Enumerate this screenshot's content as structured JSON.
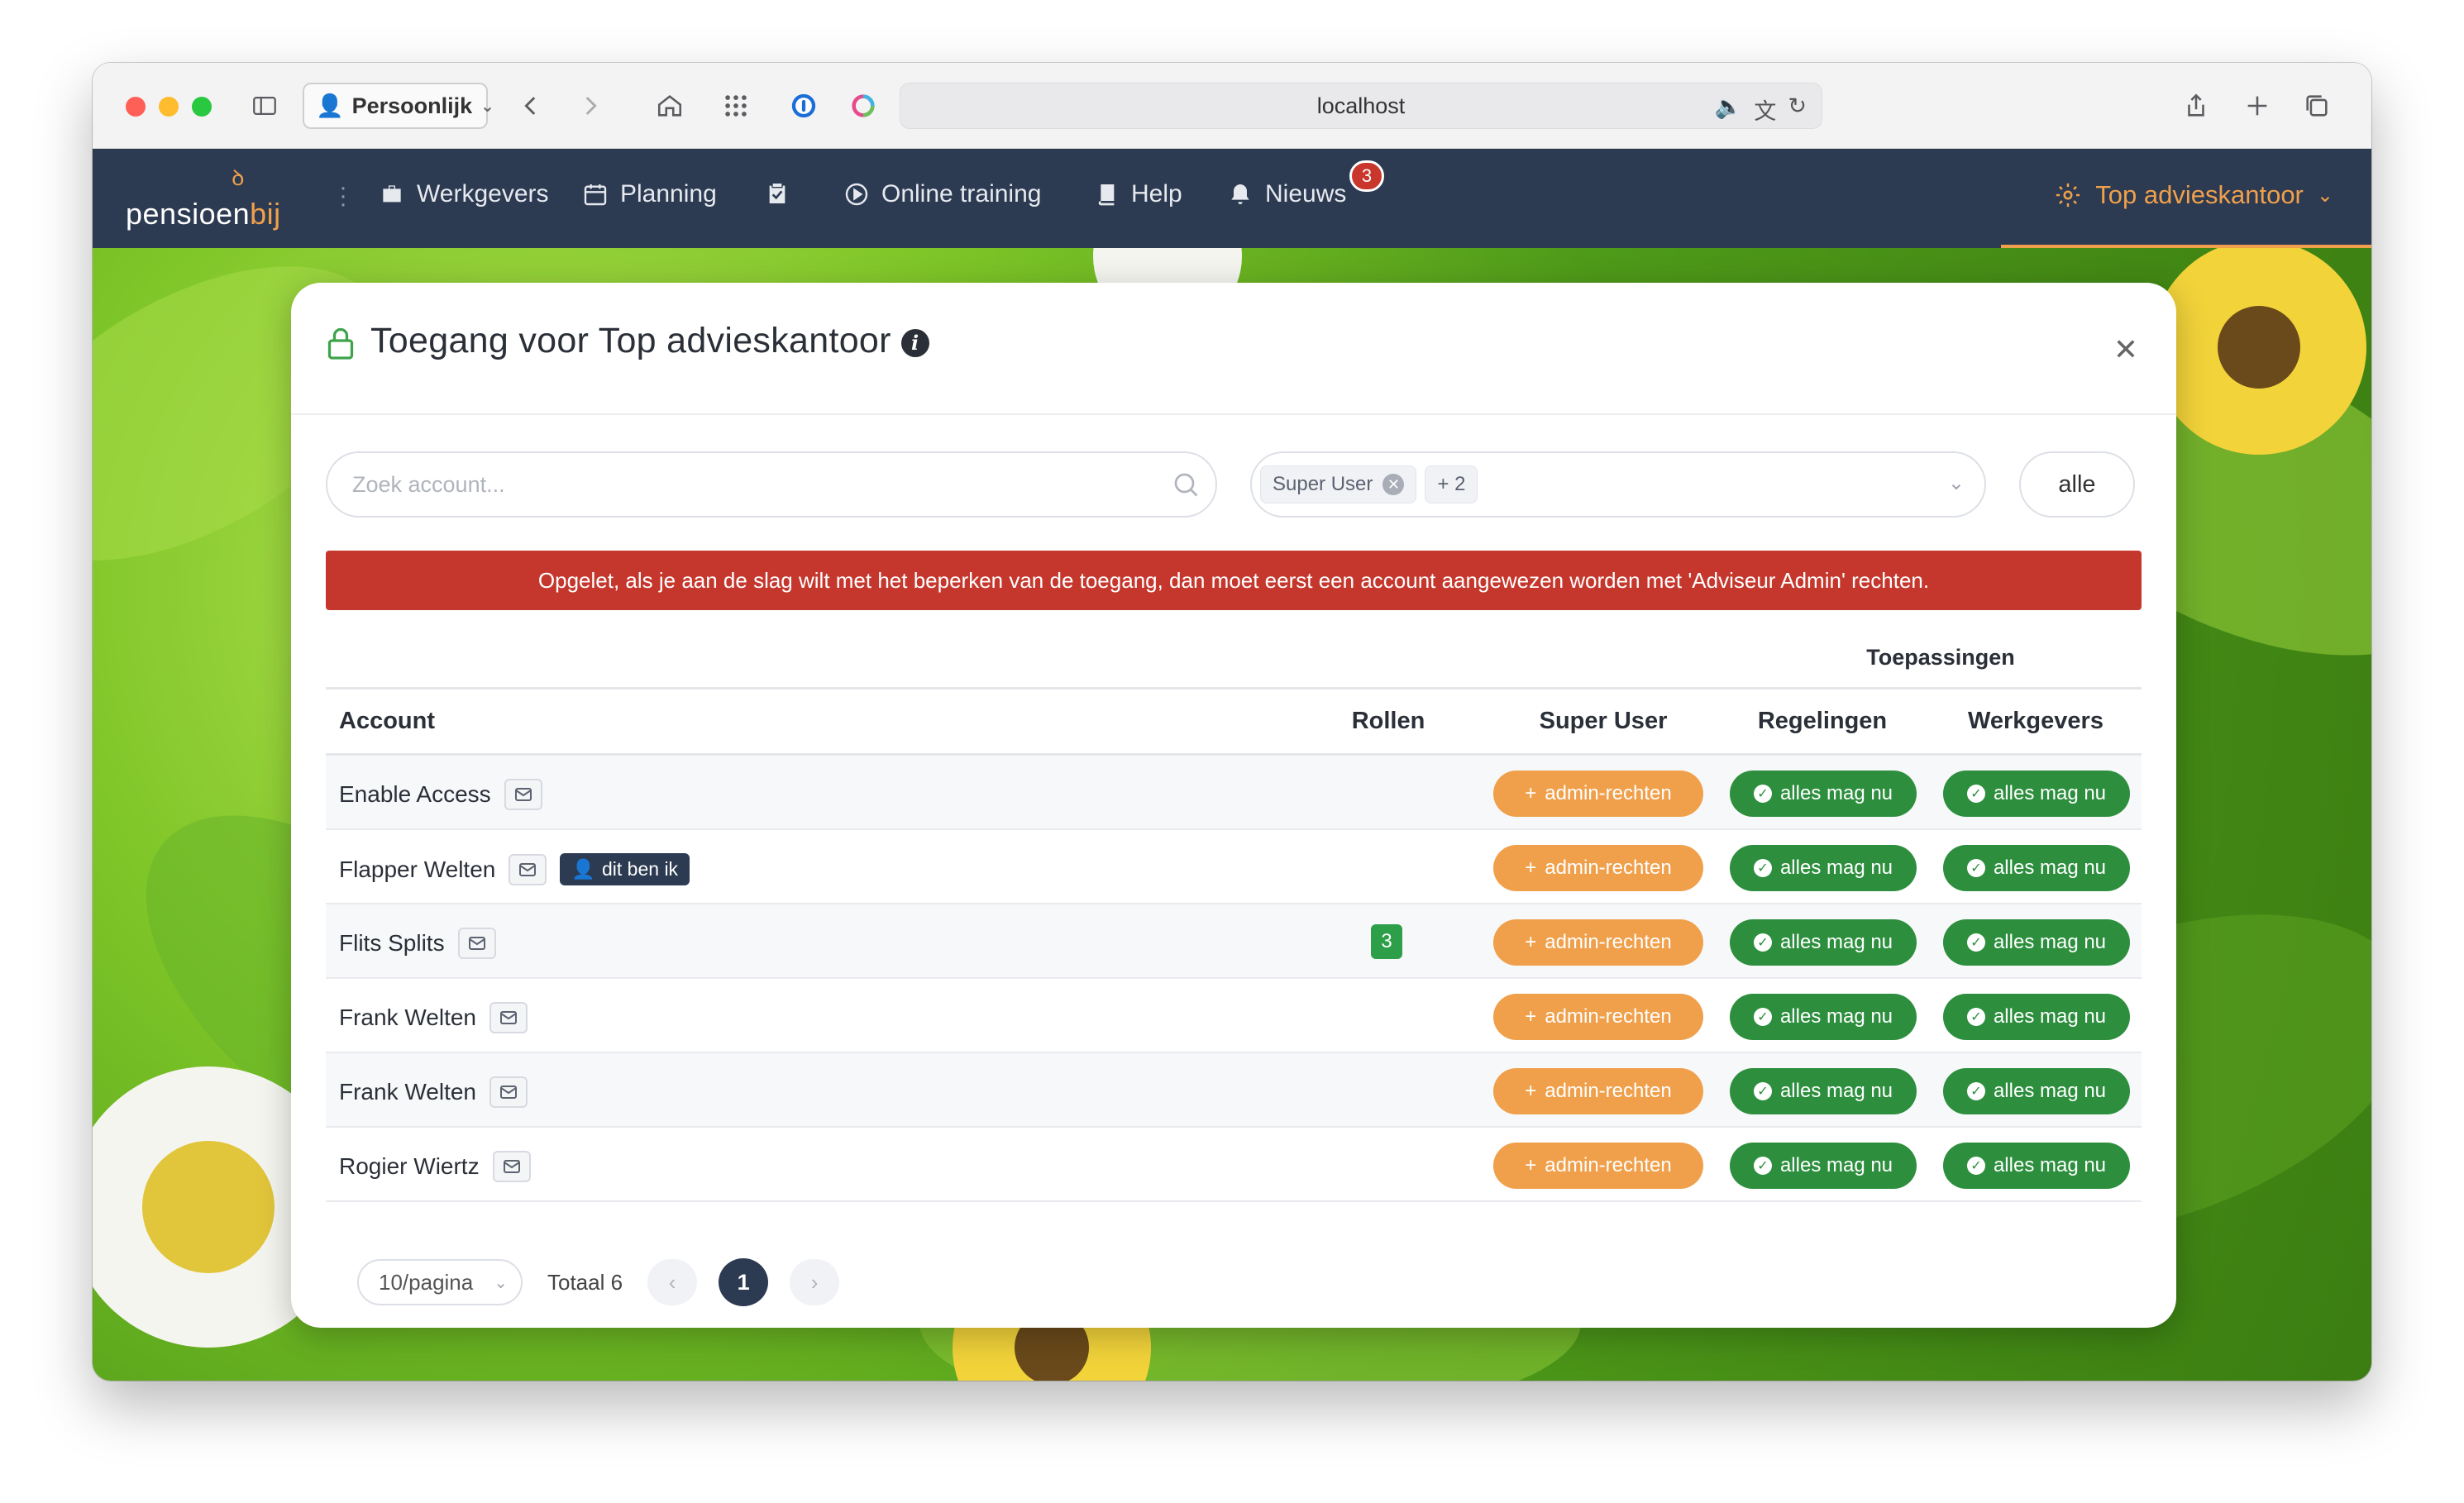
{
  "browser": {
    "profile": "Persoonlijk",
    "url": "localhost"
  },
  "nav": {
    "logo_main": "pensioen",
    "logo_accent": "bij",
    "items": [
      {
        "label": "Werkgevers",
        "icon": "briefcase-icon"
      },
      {
        "label": "Planning",
        "icon": "calendar-icon"
      },
      {
        "label": "",
        "icon": "clipboard-check-icon"
      },
      {
        "label": "Online training",
        "icon": "play-circle-icon"
      },
      {
        "label": "Help",
        "icon": "book-icon"
      },
      {
        "label": "Nieuws",
        "icon": "bell-icon"
      }
    ],
    "news_badge": "3",
    "org": "Top advieskantoor"
  },
  "modal": {
    "title": "Toegang voor Top advieskantoor",
    "search_placeholder": "Zoek account...",
    "filter_tag": "Super User",
    "filter_more": "+ 2",
    "all_button": "alle",
    "alert": "Opgelet, als je aan de slag wilt met het beperken van de toegang, dan moet eerst een account aangewezen worden met 'Adviseur Admin' rechten.",
    "group_header": "Toepassingen",
    "columns": {
      "account": "Account",
      "rollen": "Rollen",
      "super_user": "Super User",
      "regelingen": "Regelingen",
      "werkgevers": "Werkgevers"
    },
    "admin_label": "admin-rechten",
    "ok_label": "alles mag nu",
    "me_label": "dit ben ik",
    "rows": [
      {
        "name": "Enable Access",
        "roles": ""
      },
      {
        "name": "Flapper Welten",
        "roles": ""
      },
      {
        "name": "Flits Splits",
        "roles": "3"
      },
      {
        "name": "Frank Welten",
        "roles": ""
      },
      {
        "name": "Frank Welten",
        "roles": ""
      },
      {
        "name": "Rogier Wiertz",
        "roles": ""
      }
    ],
    "pager": {
      "per_page": "10/pagina",
      "total": "Totaal 6",
      "current": "1"
    }
  }
}
